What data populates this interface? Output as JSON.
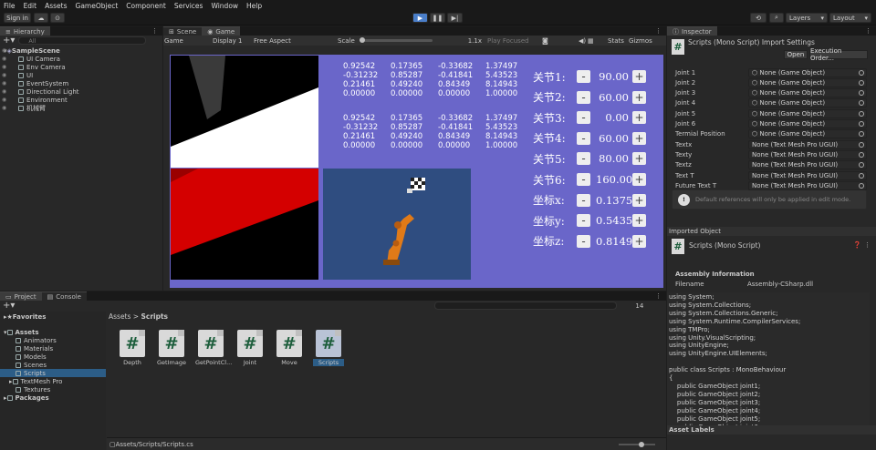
{
  "menu": [
    "File",
    "Edit",
    "Assets",
    "GameObject",
    "Component",
    "Services",
    "Window",
    "Help"
  ],
  "toolbar": {
    "sign_in": "Sign in",
    "layers": "Layers",
    "layout": "Layout"
  },
  "hierarchy": {
    "tab": "Hierarchy",
    "search_placeholder": "All",
    "items": [
      {
        "label": "SampleScene",
        "indent": 0
      },
      {
        "label": "UI Camera",
        "indent": 2
      },
      {
        "label": "Env Camera",
        "indent": 2
      },
      {
        "label": "UI",
        "indent": 2
      },
      {
        "label": "EventSystem",
        "indent": 2
      },
      {
        "label": "Directional Light",
        "indent": 2
      },
      {
        "label": "Environment",
        "indent": 2
      },
      {
        "label": "机械臂",
        "indent": 2
      }
    ]
  },
  "scene_tabs": {
    "scene": "Scene",
    "game": "Game"
  },
  "game_bar": {
    "mode": "Game",
    "display": "Display 1",
    "aspect": "Free Aspect",
    "scale_label": "Scale",
    "scale_value": "1.1x",
    "play_focused": "Play Focused",
    "stats": "Stats",
    "gizmos": "Gizmos"
  },
  "matrix1": [
    [
      "0.92542",
      "0.17365",
      "-0.33682",
      "1.37497"
    ],
    [
      "-0.31232",
      "0.85287",
      "-0.41841",
      "5.43523"
    ],
    [
      "0.21461",
      "0.49240",
      "0.84349",
      "8.14943"
    ],
    [
      "0.00000",
      "0.00000",
      "0.00000",
      "1.00000"
    ]
  ],
  "matrix2": [
    [
      "0.92542",
      "0.17365",
      "-0.33682",
      "1.37497"
    ],
    [
      "-0.31232",
      "0.85287",
      "-0.41841",
      "5.43523"
    ],
    [
      "0.21461",
      "0.49240",
      "0.84349",
      "8.14943"
    ],
    [
      "0.00000",
      "0.00000",
      "0.00000",
      "1.00000"
    ]
  ],
  "joints": [
    {
      "label": "关节1:",
      "value": "90.00"
    },
    {
      "label": "关节2:",
      "value": "60.00"
    },
    {
      "label": "关节3:",
      "value": "0.00"
    },
    {
      "label": "关节4:",
      "value": "60.00"
    },
    {
      "label": "关节5:",
      "value": "80.00"
    },
    {
      "label": "关节6:",
      "value": "160.00"
    },
    {
      "label": "坐标x:",
      "value": "0.1375"
    },
    {
      "label": "坐标y:",
      "value": "0.5435"
    },
    {
      "label": "坐标z:",
      "value": "0.8149"
    }
  ],
  "btn": {
    "minus": "-",
    "plus": "+"
  },
  "inspector": {
    "tab": "Inspector",
    "title": "Scripts (Mono Script) Import Settings",
    "open": "Open",
    "exec_order": "Execution Order...",
    "fields": [
      {
        "label": "Joint 1",
        "value": "None (Game Object)"
      },
      {
        "label": "Joint 2",
        "value": "None (Game Object)"
      },
      {
        "label": "Joint 3",
        "value": "None (Game Object)"
      },
      {
        "label": "Joint 4",
        "value": "None (Game Object)"
      },
      {
        "label": "Joint 5",
        "value": "None (Game Object)"
      },
      {
        "label": "Joint 6",
        "value": "None (Game Object)"
      },
      {
        "label": "Termial Position",
        "value": "None (Game Object)"
      },
      {
        "label": "Textx",
        "value": "None (Text Mesh Pro UGUI)"
      },
      {
        "label": "Texty",
        "value": "None (Text Mesh Pro UGUI)"
      },
      {
        "label": "Textz",
        "value": "None (Text Mesh Pro UGUI)"
      },
      {
        "label": "Text T",
        "value": "None (Text Mesh Pro UGUI)"
      },
      {
        "label": "Future Text T",
        "value": "None (Text Mesh Pro UGUI)"
      }
    ],
    "warning": "Default references will only be applied in edit mode.",
    "imported_object": "Imported Object",
    "script_title": "Scripts (Mono Script)",
    "assembly_info": "Assembly Information",
    "filename_label": "Filename",
    "filename_value": "Assembly-CSharp.dll",
    "code": "using System;\nusing System.Collections;\nusing System.Collections.Generic;\nusing System.Runtime.CompilerServices;\nusing TMPro;\nusing Unity.VisualScripting;\nusing UnityEngine;\nusing UnityEngine.UIElements;\n\npublic class Scripts : MonoBehaviour\n{\n    public GameObject joint1;\n    public GameObject joint2;\n    public GameObject joint3;\n    public GameObject joint4;\n    public GameObject joint5;\n    public GameObject joint6;\n    public GameObject termialPosition;",
    "asset_labels": "Asset Labels"
  },
  "project": {
    "tab_project": "Project",
    "tab_console": "Console",
    "favorites": "Favorites",
    "assets": "Assets",
    "folders": [
      "Animators",
      "Materials",
      "Models",
      "Scenes",
      "Scripts",
      "TextMesh Pro",
      "Textures"
    ],
    "packages": "Packages",
    "breadcrumb_root": "Assets",
    "breadcrumb_leaf": "Scripts",
    "files": [
      "Depth",
      "GetImage",
      "GetPointCl...",
      "Joint",
      "Move",
      "Scripts"
    ],
    "count": "14",
    "status_path": "Assets/Scripts/Scripts.cs"
  }
}
